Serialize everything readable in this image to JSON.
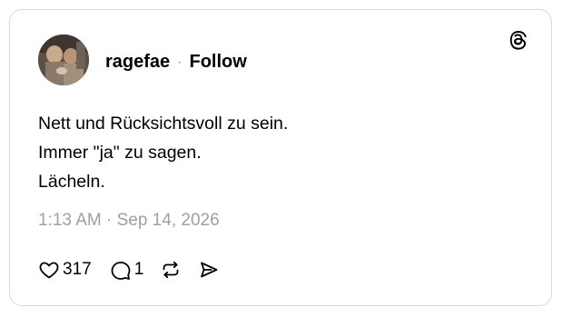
{
  "post": {
    "author": {
      "username": "ragefae",
      "separator": "·",
      "follow_label": "Follow"
    },
    "text_lines": [
      "Nett und Rücksichtsvoll zu sein.",
      "Immer \"ja\" zu sagen.",
      "Lächeln."
    ],
    "timestamp": "1:13 AM · Sep 14, 2026",
    "stats": {
      "likes": "317",
      "replies": "1"
    }
  },
  "icons": {
    "brand": "threads-logo-icon",
    "like": "heart-icon",
    "reply": "speech-bubble-icon",
    "repost": "repost-icon",
    "share": "send-icon"
  },
  "colors": {
    "text": "#000000",
    "muted": "#a0a0a0",
    "border": "#d9d9d9",
    "background": "#ffffff"
  }
}
